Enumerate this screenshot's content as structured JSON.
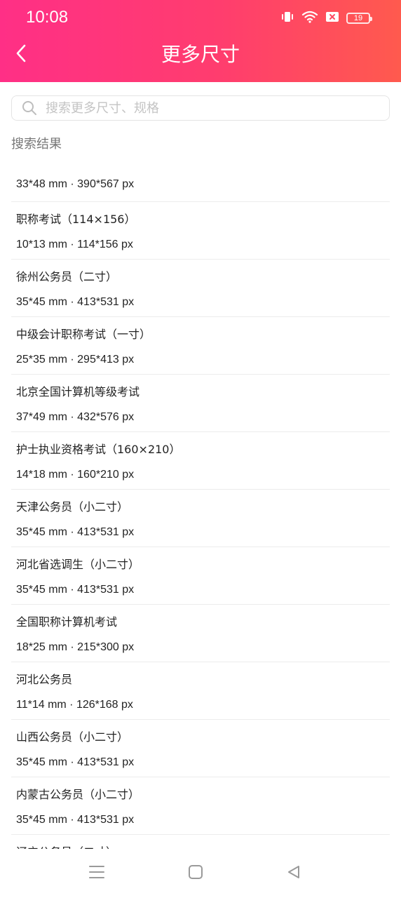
{
  "status_bar": {
    "time": "10:08",
    "battery": "19",
    "icons": [
      "vibrate-icon",
      "wifi-icon",
      "sim-blocked-icon",
      "battery-icon"
    ]
  },
  "nav": {
    "title": "更多尺寸",
    "back_icon": "chevron-left-icon"
  },
  "search": {
    "placeholder": "搜索更多尺寸、规格",
    "value": ""
  },
  "section": {
    "label": "搜索结果"
  },
  "results": [
    {
      "name": "",
      "spec": "33*48 mm · 390*567 px"
    },
    {
      "name": "职称考试（114×156）",
      "spec": "10*13 mm · 114*156 px"
    },
    {
      "name": "徐州公务员（二寸）",
      "spec": "35*45 mm · 413*531 px"
    },
    {
      "name": "中级会计职称考试（一寸）",
      "spec": "25*35 mm · 295*413 px"
    },
    {
      "name": "北京全国计算机等级考试",
      "spec": "37*49 mm · 432*576 px"
    },
    {
      "name": "护士执业资格考试（160×210）",
      "spec": "14*18 mm · 160*210 px"
    },
    {
      "name": "天津公务员（小二寸）",
      "spec": "35*45 mm · 413*531 px"
    },
    {
      "name": "河北省选调生（小二寸）",
      "spec": "35*45 mm · 413*531 px"
    },
    {
      "name": "全国职称计算机考试",
      "spec": "18*25 mm · 215*300 px"
    },
    {
      "name": "河北公务员",
      "spec": "11*14 mm · 126*168 px"
    },
    {
      "name": "山西公务员（小二寸）",
      "spec": "35*45 mm · 413*531 px"
    },
    {
      "name": "内蒙古公务员（小二寸）",
      "spec": "35*45 mm · 413*531 px"
    },
    {
      "name": "辽宁公务员（二寸）",
      "spec": ""
    }
  ],
  "system_nav": {
    "buttons": [
      "menu-icon",
      "home-icon",
      "back-triangle-icon"
    ]
  },
  "colors": {
    "header_gradient_start": "#ff2f86",
    "header_gradient_end": "#ff5a4e",
    "divider": "#ececec",
    "placeholder": "#c4c4c4",
    "section_label": "#777777"
  }
}
